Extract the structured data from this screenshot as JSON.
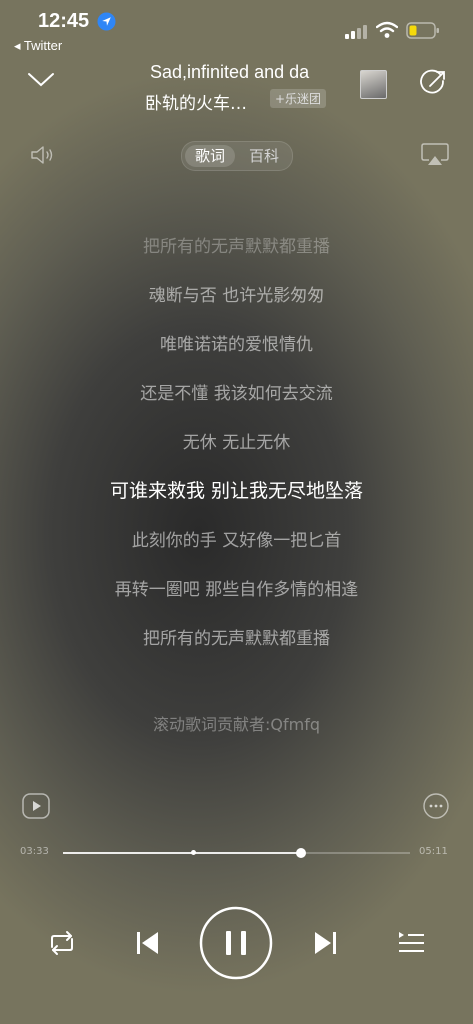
{
  "status_bar": {
    "time": "12:45",
    "back_app": "◂ Twitter"
  },
  "header": {
    "song_title": "Sad,infinited and da",
    "artist": "卧轨的火车…",
    "join_label": "+乐迷团"
  },
  "tabs": [
    {
      "label": "歌词"
    },
    {
      "label": "百科"
    }
  ],
  "lyrics": [
    "把所有的无声默默都重播",
    "魂断与否 也许光影匆匆",
    "唯唯诺诺的爱恨情仇",
    "还是不懂 我该如何去交流",
    "无休 无止无休",
    "可谁来救我 别让我无尽地坠落",
    "此刻你的手 又好像一把匕首",
    "再转一圈吧 那些自作多情的相逢",
    "把所有的无声默默都重播"
  ],
  "current_lyric_index": 5,
  "contributor": "滚动歌词贡献者:Qfmfq",
  "progress": {
    "current": "03:33",
    "total": "05:11",
    "fraction": 0.685,
    "buffer_fraction": 0.375
  },
  "icons": {
    "collapse": "chevron-down-icon",
    "share": "share-icon",
    "volume": "speaker-icon",
    "airplay": "airplay-icon",
    "video": "play-video-icon",
    "more": "more-icon",
    "repeat": "repeat-icon",
    "previous": "previous-icon",
    "pause": "pause-icon",
    "next": "next-icon",
    "playlist": "playlist-icon",
    "location": "location-arrow-icon",
    "signal": "signal-icon",
    "wifi": "wifi-icon",
    "battery": "battery-icon"
  },
  "colors": {
    "battery_fill": "#f5d90a"
  }
}
